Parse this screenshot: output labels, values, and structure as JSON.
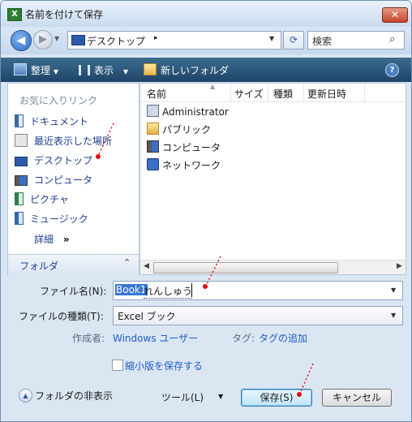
{
  "window": {
    "title": "名前を付けて保存",
    "close_label": "✕",
    "app_icon": "X"
  },
  "address": {
    "location": "デスクトップ",
    "arrow": "▸",
    "search_placeholder": "検索"
  },
  "toolbar": {
    "organize": "整理",
    "views": "表示",
    "new_folder": "新しいフォルダ",
    "help": "?"
  },
  "sidebar": {
    "header": "お気に入りリンク",
    "items": [
      {
        "label": "ドキュメント",
        "icon": "documents-icon"
      },
      {
        "label": "最近表示した場所",
        "icon": "recent-places-icon"
      },
      {
        "label": "デスクトップ",
        "icon": "desktop-icon"
      },
      {
        "label": "コンピュータ",
        "icon": "computer-icon"
      },
      {
        "label": "ピクチャ",
        "icon": "pictures-icon"
      },
      {
        "label": "ミュージック",
        "icon": "music-icon"
      }
    ],
    "details": "詳細",
    "details_chevron": "»",
    "folders": "フォルダ",
    "folders_toggle": "⌃"
  },
  "filelist": {
    "columns": [
      "名前",
      "サイズ",
      "種類",
      "更新日時"
    ],
    "items": [
      {
        "label": "Administrator",
        "icon": "user-folder-icon"
      },
      {
        "label": "パブリック",
        "icon": "public-folder-icon"
      },
      {
        "label": "コンピュータ",
        "icon": "computer-icon"
      },
      {
        "label": "ネットワーク",
        "icon": "network-icon"
      }
    ]
  },
  "form": {
    "filename_label": "ファイル名(N):",
    "filename_selected": "Book1",
    "filename_composing": "れんしゅう",
    "filetype_label": "ファイルの種類(T):",
    "filetype_value": "Excel ブック",
    "author_label": "作成者:",
    "author_value": "Windows ユーザー",
    "tags_label": "タグ:",
    "tags_value": "タグの追加",
    "thumbnail_label": "縮小版を保存する"
  },
  "footer": {
    "hide_folders": "フォルダの非表示",
    "tools": "ツール(L)",
    "save": "保存(S)",
    "cancel": "キャンセル"
  },
  "colors": {
    "toolbar": "#1d4468",
    "link": "#1f3f8f",
    "annotation": "#e01010",
    "selection": "#3a78d4"
  }
}
